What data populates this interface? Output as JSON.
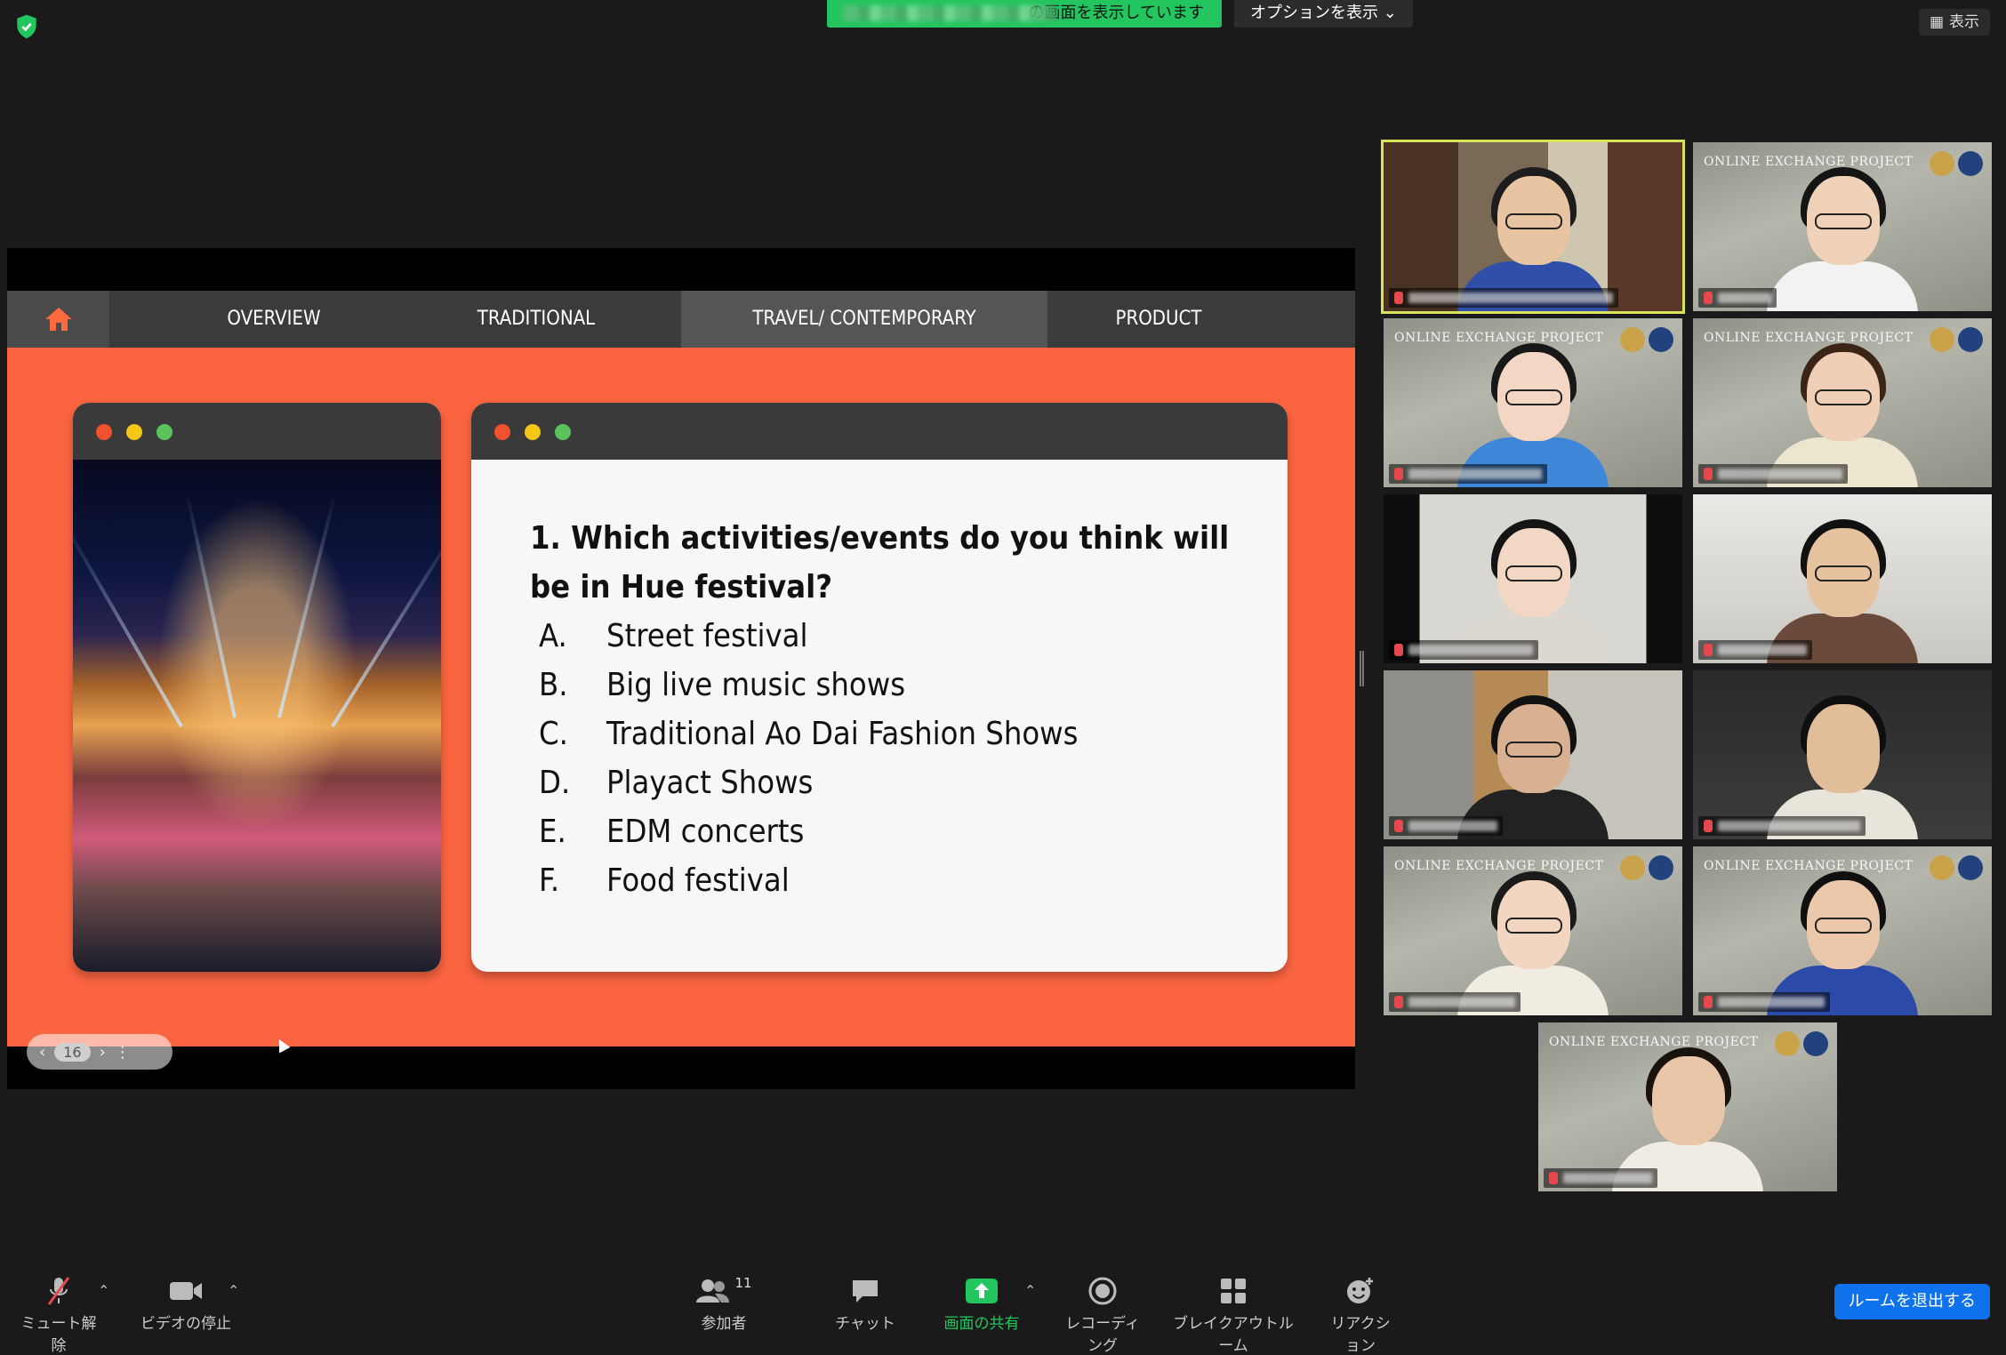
{
  "topbar": {
    "share_banner": "の画面を表示しています",
    "options_label": "オプションを表示",
    "view_label": "表示"
  },
  "slide": {
    "nav_tabs": [
      "OVERVIEW",
      "TRADITIONAL",
      "TRAVEL/ CONTEMPORARY",
      "PRODUCT"
    ],
    "active_tab": "TRAVEL/ CONTEMPORARY",
    "question": "1. Which activities/events do you think will be in Hue festival?",
    "options": [
      {
        "letter": "A.",
        "text": "Street festival"
      },
      {
        "letter": "B.",
        "text": "Big live music shows"
      },
      {
        "letter": "C.",
        "text": "Traditional Ao Dai Fashion Shows"
      },
      {
        "letter": "D.",
        "text": "Playact Shows"
      },
      {
        "letter": "E.",
        "text": "EDM concerts"
      },
      {
        "letter": "F.",
        "text": "Food festival"
      }
    ],
    "page_number": "16",
    "colors": {
      "background": "#fa6440",
      "nav": "#3b3b3b",
      "dot_red": "#f0522f",
      "dot_yellow": "#f5c518",
      "dot_green": "#5cc25c"
    }
  },
  "gallery": {
    "virtual_background_title": "ONLINE EXCHANGE PROJECT",
    "participants": [
      {
        "active": true
      },
      {
        "active": false
      },
      {
        "active": false
      },
      {
        "active": false
      },
      {
        "active": false
      },
      {
        "active": false
      },
      {
        "active": false
      },
      {
        "active": false
      },
      {
        "active": false
      },
      {
        "active": false
      },
      {
        "active": false
      }
    ]
  },
  "toolbar": {
    "mute": "ミュート解除",
    "video": "ビデオの停止",
    "participants": "参加者",
    "participant_count": "11",
    "chat": "チャット",
    "share": "画面の共有",
    "recording": "レコーディング",
    "breakout": "ブレイクアウトルーム",
    "reaction": "リアクション",
    "leave": "ルームを退出する"
  }
}
